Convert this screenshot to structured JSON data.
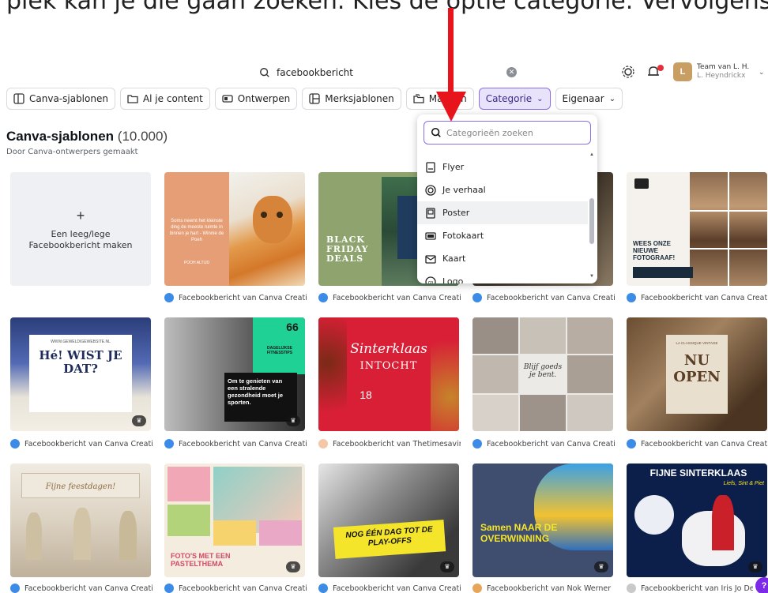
{
  "intro_text": "plek kan je die gaan zoeken. Kies de optie categorie. Vervolgens",
  "search": {
    "value": "facebookbericht",
    "clear_icon": "clear-icon"
  },
  "account": {
    "team": "Team van L. H.",
    "user": "L. Heyndrickx",
    "initials": "L"
  },
  "chips": [
    {
      "label": "Canva-sjablonen",
      "icon": "template-icon"
    },
    {
      "label": "Al je content",
      "icon": "folder-icon"
    },
    {
      "label": "Ontwerpen",
      "icon": "design-icon"
    },
    {
      "label": "Merksjablonen",
      "icon": "brand-icon"
    },
    {
      "label": "Mappen",
      "icon": "folders-icon"
    },
    {
      "label": "Categorie",
      "icon": "chevron-down-icon"
    },
    {
      "label": "Eigenaar",
      "icon": "chevron-down-icon"
    }
  ],
  "heading": {
    "title": "Canva-sjablonen",
    "count": "(10.000)",
    "subtitle": "Door Canva-ontwerpers gemaakt"
  },
  "blank_card": {
    "plus": "+",
    "label": "Een leeg/lege Facebookbericht maken"
  },
  "dropdown": {
    "placeholder": "Categorieën zoeken",
    "items": [
      {
        "label": "Flyer",
        "icon": "flyer-icon"
      },
      {
        "label": "Je verhaal",
        "icon": "story-icon"
      },
      {
        "label": "Poster",
        "icon": "poster-icon"
      },
      {
        "label": "Fotokaart",
        "icon": "photo-card-icon"
      },
      {
        "label": "Kaart",
        "icon": "card-icon"
      },
      {
        "label": "Logo",
        "icon": "logo-icon"
      }
    ]
  },
  "templates": {
    "t1": {
      "caption": "Facebookbericht van Canva Creativ...",
      "text": "Soms neemt het kleinste ding de meeste ruimte in binnen je hart - Winnie de Poeh",
      "author": "POOH ALTIJD"
    },
    "t2": {
      "caption": "Facebookbericht van Canva Creativ...",
      "text": "BLACK FRIDAY DEALS"
    },
    "t3": {
      "caption": "Facebookbericht van Canva Creativ..."
    },
    "t4": {
      "caption": "Facebookbericht van Canva Creativ...",
      "text": "WEES ONZE NIEUWE FOTOGRAAF!"
    },
    "t5": {
      "caption": "Facebookbericht van Canva Creativ...",
      "text": "Hé! WIST JE DAT?",
      "small": "WWW.GEWELDIGEWEBSITE.NL"
    },
    "t6": {
      "caption": "Facebookbericht van Canva Creativ...",
      "text": "Om te genieten van een stralende gezondheid moet je sporten.",
      "tag": "DAGELIJKSE FITNESSTIPS",
      "quote": "66"
    },
    "t7": {
      "caption": "Facebookbericht van Thetimesaving...",
      "text": "Sinterklaas",
      "sub": "INTOCHT",
      "date": "18"
    },
    "t8": {
      "caption": "Facebookbericht van Canva Creativ...",
      "text": "Blijf goeds je bent."
    },
    "t9": {
      "caption": "Facebookbericht van Canva Creativ...",
      "text": "NU OPEN",
      "small": "LA CLASSIQUE VINTAGE"
    },
    "t10": {
      "caption": "Facebookbericht van Canva Creativ...",
      "text": "Fijne feestdagen!"
    },
    "t11": {
      "caption": "Facebookbericht van Canva Creativ...",
      "text": "FOTO'S MET EEN PASTELTHEMA"
    },
    "t12": {
      "caption": "Facebookbericht van Canva Creativ...",
      "text": "NOG ÉÉN DAG TOT DE PLAY-OFFS"
    },
    "t13": {
      "caption": "Facebookbericht van Nok Werner",
      "text": "Samen NAAR DE OVERWINNING"
    },
    "t14": {
      "caption": "Facebookbericht van Iris Jo Desc...",
      "text": "FIJNE SINTERKLAAS",
      "sub": "Liefs, Sint & Piet"
    }
  },
  "help": "?"
}
